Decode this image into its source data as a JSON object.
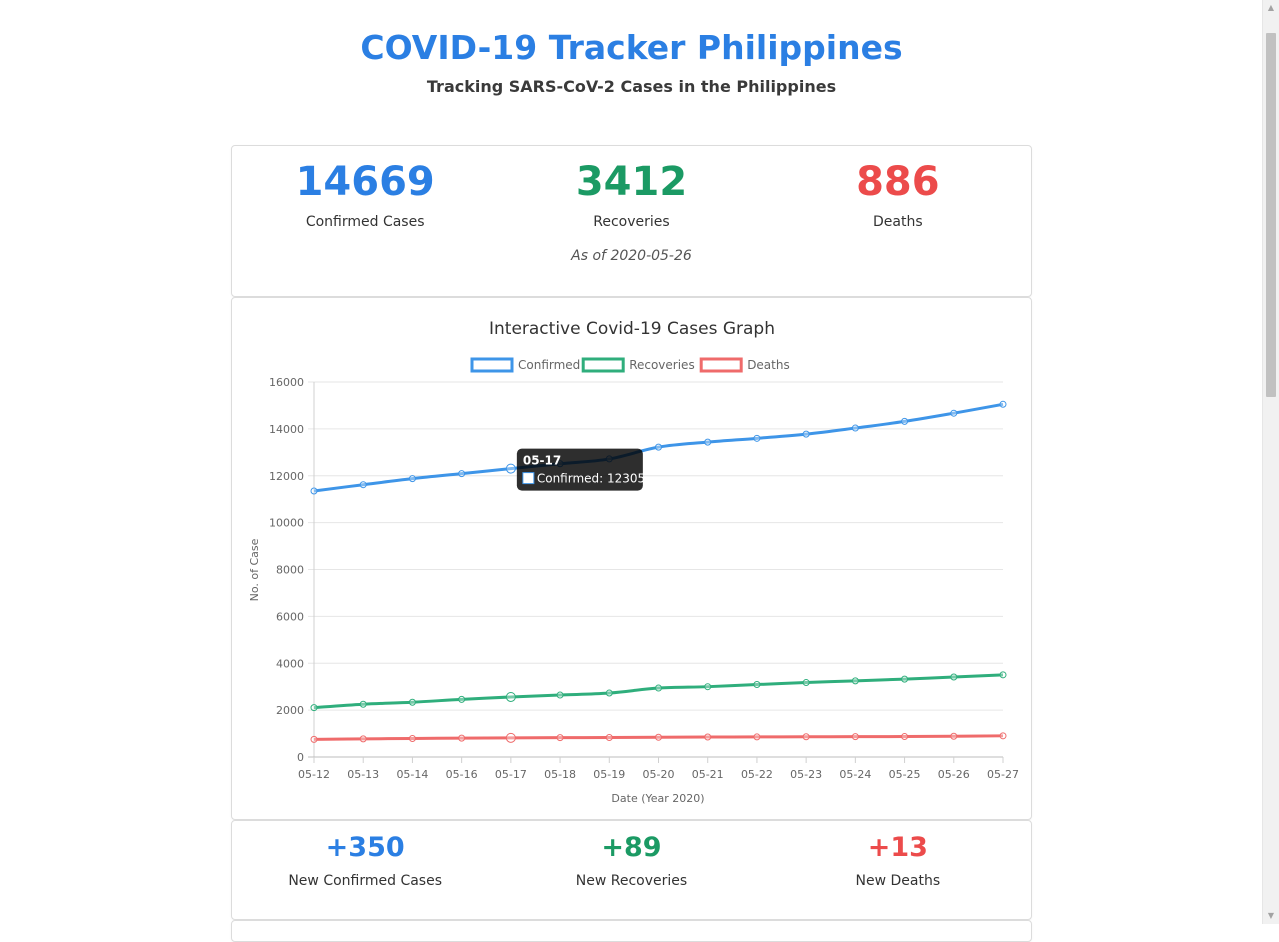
{
  "header": {
    "title": "COVID-19 Tracker Philippines",
    "subtitle": "Tracking SARS-CoV-2 Cases in the Philippines"
  },
  "stats": {
    "confirmed": {
      "value": "14669",
      "label": "Confirmed Cases"
    },
    "recoveries": {
      "value": "3412",
      "label": "Recoveries"
    },
    "deaths": {
      "value": "886",
      "label": "Deaths"
    },
    "as_of": "As of 2020-05-26"
  },
  "new_stats": {
    "confirmed": {
      "value": "+350",
      "label": "New Confirmed Cases"
    },
    "recoveries": {
      "value": "+89",
      "label": "New Recoveries"
    },
    "deaths": {
      "value": "+13",
      "label": "New Deaths"
    }
  },
  "colors": {
    "confirmed": "#3e95e8",
    "recoveries": "#2fae7c",
    "deaths": "#ef6b6b",
    "brand_blue": "#2b7fe3"
  },
  "icons": {
    "scroll_up": "scroll-up-arrow-icon",
    "scroll_down": "scroll-down-arrow-icon"
  },
  "chart_data": {
    "type": "line",
    "title": "Interactive Covid-19 Cases Graph",
    "xlabel": "Date (Year 2020)",
    "ylabel": "No. of Case",
    "ylim": [
      0,
      16000
    ],
    "yticks": [
      0,
      2000,
      4000,
      6000,
      8000,
      10000,
      12000,
      14000,
      16000
    ],
    "grid": true,
    "legend_position": "top",
    "categories": [
      "05-12",
      "05-13",
      "05-14",
      "05-16",
      "05-17",
      "05-18",
      "05-19",
      "05-20",
      "05-21",
      "05-22",
      "05-23",
      "05-24",
      "05-25",
      "05-26",
      "05-27"
    ],
    "series": [
      {
        "name": "Confirmed",
        "color": "#3e95e8",
        "values": [
          11350,
          11618,
          11876,
          12091,
          12305,
          12513,
          12718,
          13221,
          13434,
          13597,
          13777,
          14035,
          14319,
          14669,
          15049
        ]
      },
      {
        "name": "Recoveries",
        "color": "#2fae7c",
        "values": [
          2106,
          2251,
          2337,
          2460,
          2561,
          2643,
          2729,
          2942,
          3000,
          3092,
          3177,
          3249,
          3323,
          3412,
          3506
        ]
      },
      {
        "name": "Deaths",
        "color": "#ef6b6b",
        "values": [
          751,
          772,
          790,
          806,
          817,
          826,
          831,
          842,
          852,
          857,
          863,
          868,
          873,
          886,
          904
        ]
      }
    ],
    "tooltip": {
      "title": "05-17",
      "text": "Confirmed: 12305"
    }
  }
}
